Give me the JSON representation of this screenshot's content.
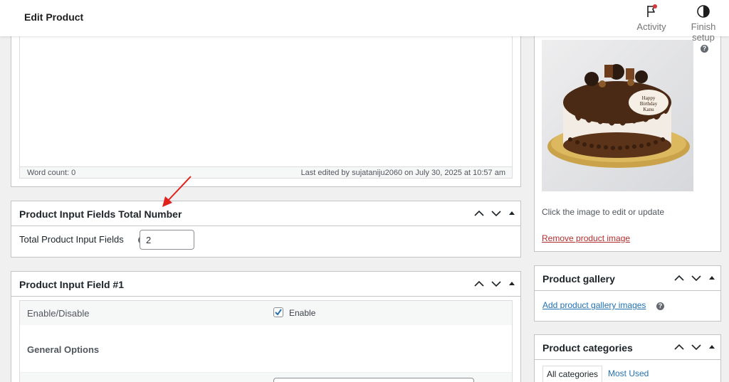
{
  "topbar": {
    "title": "Edit Product",
    "activity_label": "Activity",
    "finish_setup_label": "Finish setup"
  },
  "editor": {
    "word_count": "Word count: 0",
    "last_edited": "Last edited by sujataniju2060 on July 30, 2025 at 10:57 am"
  },
  "total_box": {
    "title": "Product Input Fields Total Number",
    "label": "Total Product Input Fields",
    "value": "2"
  },
  "field_box": {
    "title": "Product Input Field #1",
    "enable_label": "Enable/Disable",
    "enable_checkbox_label": "Enable",
    "enabled": true,
    "general_options": "General Options"
  },
  "product_image": {
    "help_text": "Click the image to edit or update",
    "remove_link": "Remove product image",
    "cake_text": "Happy Birthday Kanu"
  },
  "gallery": {
    "title": "Product gallery",
    "add_link": "Add product gallery images"
  },
  "categories": {
    "title": "Product categories",
    "tab_all": "All categories",
    "tab_most_used": "Most Used"
  },
  "colors": {
    "link": "#2271b1",
    "danger": "#b32d2e",
    "checkbox": "#2271b1",
    "annotation_arrow": "#e0211c"
  }
}
